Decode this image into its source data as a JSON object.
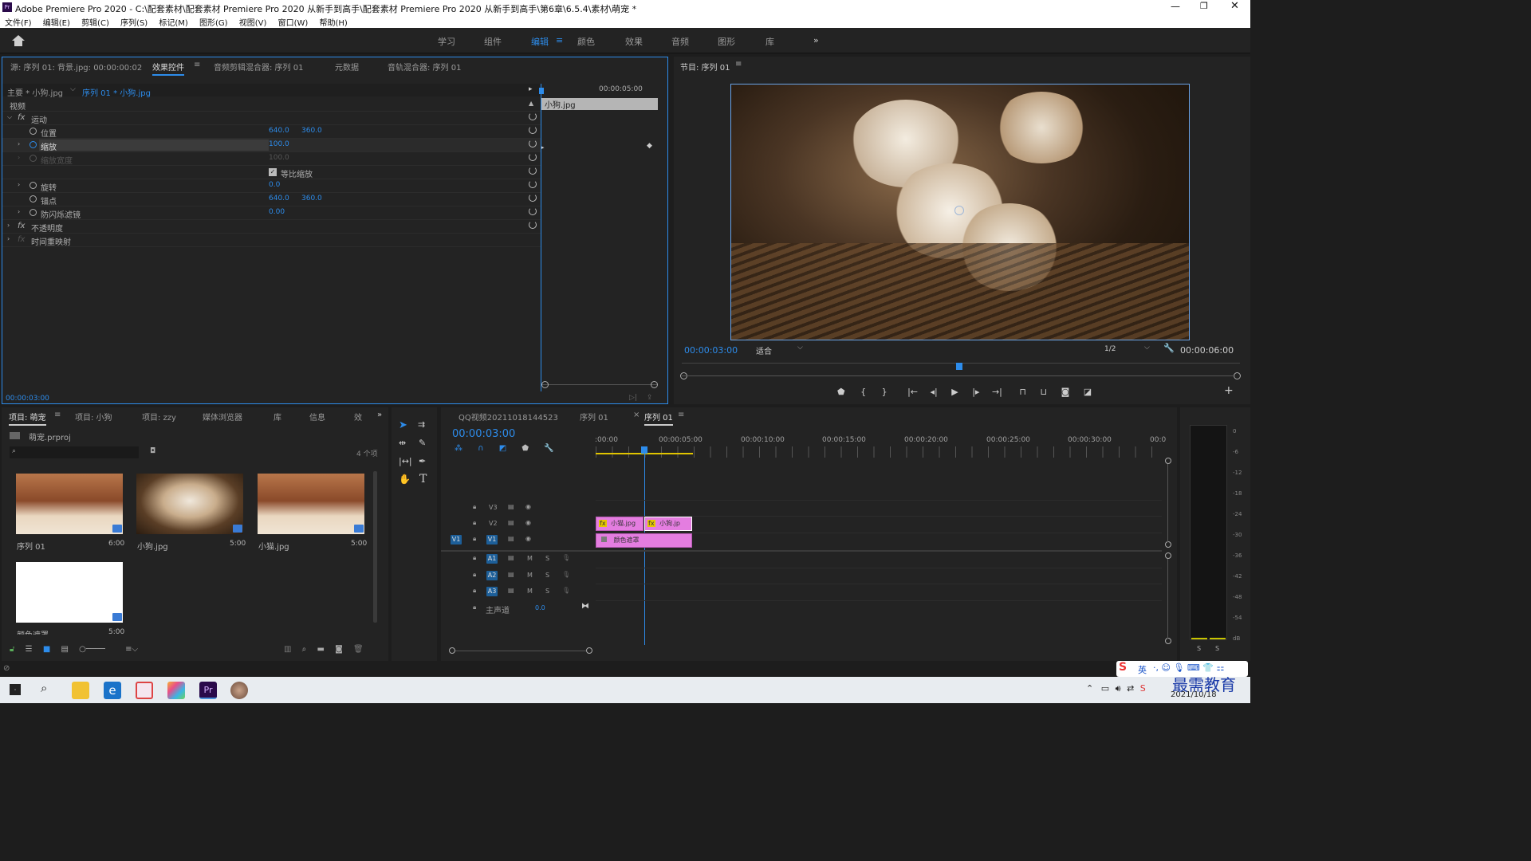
{
  "app": {
    "title": "Adobe Premiere Pro 2020 - C:\\配套素材\\配套素材 Premiere Pro 2020 从新手到高手\\配套素材 Premiere Pro 2020 从新手到高手\\第6章\\6.5.4\\素材\\萌宠 *",
    "menus": [
      "文件(F)",
      "编辑(E)",
      "剪辑(C)",
      "序列(S)",
      "标记(M)",
      "图形(G)",
      "视图(V)",
      "窗口(W)",
      "帮助(H)"
    ]
  },
  "workspaces": {
    "tabs": [
      "学习",
      "组件",
      "编辑",
      "颜色",
      "效果",
      "音频",
      "图形",
      "库"
    ],
    "active": "编辑",
    "more": "»"
  },
  "effect_controls": {
    "tabs": [
      "源: 序列 01: 背景.jpg: 00:00:00:02",
      "效果控件",
      "音频剪辑混合器: 序列 01",
      "元数据",
      "音轨混合器: 序列 01"
    ],
    "active_tab": "效果控件",
    "master_label": "主要 * 小狗.jpg",
    "sequence_label": "序列 01 * 小狗.jpg",
    "ruler_time": "00:00:05:00",
    "clip_name": "小狗.jpg",
    "section_video": "视频",
    "motion": "运动",
    "props": [
      {
        "name": "位置",
        "v1": "640.0",
        "v2": "360.0"
      },
      {
        "name": "缩放",
        "v1": "100.0",
        "v2": ""
      },
      {
        "name": "缩放宽度",
        "v1": "100.0",
        "v2": ""
      },
      {
        "name": "等比缩放",
        "v1": "",
        "v2": ""
      },
      {
        "name": "旋转",
        "v1": "0.0",
        "v2": ""
      },
      {
        "name": "锚点",
        "v1": "640.0",
        "v2": "360.0"
      },
      {
        "name": "防闪烁滤镜",
        "v1": "0.00",
        "v2": ""
      }
    ],
    "opacity": "不透明度",
    "time_remap": "时间重映射",
    "fx_label": "fx",
    "current_time": "00:00:03:00"
  },
  "program": {
    "title": "节目: 序列 01",
    "timecode": "00:00:03:00",
    "fit": "适合",
    "quality": "1/2",
    "duration": "00:00:06:00"
  },
  "project": {
    "tabs": [
      "项目: 萌宠",
      "项目: 小狗",
      "项目: zzy",
      "媒体浏览器",
      "库",
      "信息",
      "效"
    ],
    "active_tab": "项目: 萌宠",
    "file": "萌宠.prproj",
    "count": "4 个项",
    "items": [
      {
        "name": "序列 01",
        "dur": "6:00"
      },
      {
        "name": "小狗.jpg",
        "dur": "5:00"
      },
      {
        "name": "小猫.jpg",
        "dur": "5:00"
      },
      {
        "name": "颜色遮罩",
        "dur": "5:00"
      }
    ]
  },
  "timeline": {
    "tabs": [
      "QQ视频20211018144523",
      "序列 01",
      "序列 01"
    ],
    "active_tab": "序列 01",
    "timecode": "00:00:03:00",
    "ruler": [
      ":00:00",
      "00:00:05:00",
      "00:00:10:00",
      "00:00:15:00",
      "00:00:20:00",
      "00:00:25:00",
      "00:00:30:00",
      "00:0"
    ],
    "video_tracks": [
      "V3",
      "V2",
      "V1"
    ],
    "audio_tracks": [
      "A1",
      "A2",
      "A3"
    ],
    "source_patch": "V1",
    "master_label": "主声道",
    "master_value": "0.0",
    "clips": {
      "v2a": "小猫.jpg",
      "v2b": "小狗.jp",
      "v1": "颜色遮罩"
    },
    "m_label": "M",
    "s_label": "S"
  },
  "meter": {
    "ticks": [
      "0",
      "-6",
      "-12",
      "-18",
      "-24",
      "-30",
      "-36",
      "-42",
      "-48",
      "-54",
      "dB"
    ],
    "solo": [
      "S",
      "S"
    ]
  },
  "taskbar": {
    "date": "2021/10/18",
    "ime": "英",
    "watermark": "最需教育"
  }
}
